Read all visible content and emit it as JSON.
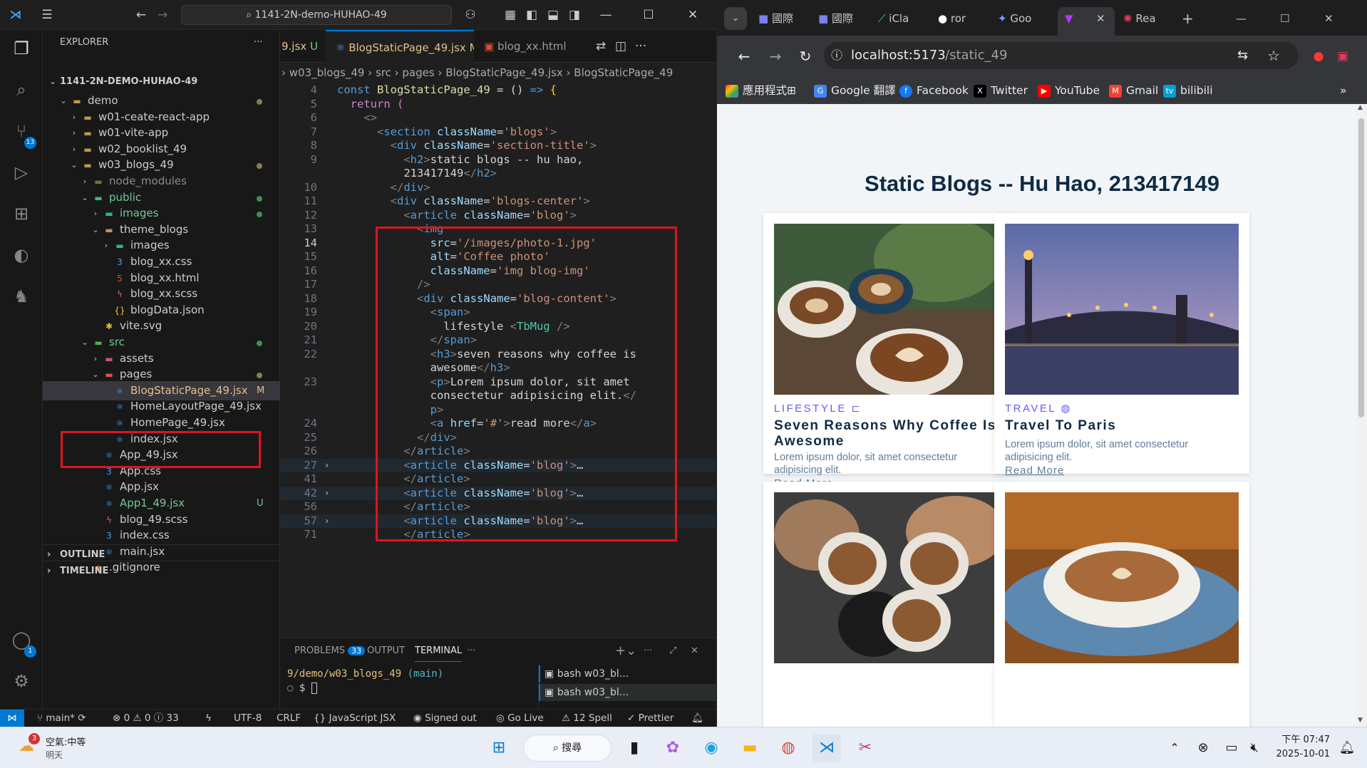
{
  "vscode": {
    "title_search": "1141-2N-demo-HUHAO-49",
    "activity_badges": {
      "source_control": "13",
      "accounts": "1"
    },
    "sidebar": {
      "header": "EXPLORER",
      "root": "1141-2N-DEMO-HUHAO-49",
      "tree": [
        {
          "label": "demo",
          "type": "folder",
          "open": true,
          "depth": 1,
          "status": "dot-gray"
        },
        {
          "label": "w01-ceate-react-app",
          "type": "folder",
          "open": false,
          "depth": 2,
          "status": ""
        },
        {
          "label": "w01-vite-app",
          "type": "folder",
          "open": false,
          "depth": 2,
          "status": ""
        },
        {
          "label": "w02_booklist_49",
          "type": "folder",
          "open": false,
          "depth": 2,
          "status": ""
        },
        {
          "label": "w03_blogs_49",
          "type": "folder",
          "open": true,
          "depth": 2,
          "status": "dot-gray"
        },
        {
          "label": "node_modules",
          "type": "folder-dim",
          "open": false,
          "depth": 3,
          "status": ""
        },
        {
          "label": "public",
          "type": "folder-public",
          "open": true,
          "depth": 3,
          "status": "dot-green"
        },
        {
          "label": "images",
          "type": "folder-images",
          "open": false,
          "depth": 4,
          "status": "dot-green"
        },
        {
          "label": "theme_blogs",
          "type": "folder",
          "open": true,
          "depth": 4,
          "status": ""
        },
        {
          "label": "images",
          "type": "folder-images",
          "open": false,
          "depth": 5,
          "status": ""
        },
        {
          "label": "blog_xx.css",
          "type": "css",
          "depth": 5,
          "status": ""
        },
        {
          "label": "blog_xx.html",
          "type": "html",
          "depth": 5,
          "status": ""
        },
        {
          "label": "blog_xx.scss",
          "type": "scss",
          "depth": 5,
          "status": ""
        },
        {
          "label": "blogData.json",
          "type": "json",
          "depth": 5,
          "status": ""
        },
        {
          "label": "vite.svg",
          "type": "svg",
          "depth": 4,
          "status": ""
        },
        {
          "label": "src",
          "type": "folder-src",
          "open": true,
          "depth": 3,
          "status": "dot-green"
        },
        {
          "label": "assets",
          "type": "folder-assets",
          "open": false,
          "depth": 4,
          "status": ""
        },
        {
          "label": "pages",
          "type": "folder-pages",
          "open": true,
          "depth": 4,
          "status": "dot-gray"
        },
        {
          "label": "BlogStaticPage_49.jsx",
          "type": "jsx",
          "depth": 5,
          "status": "M",
          "selected": true
        },
        {
          "label": "HomeLayoutPage_49.jsx",
          "type": "jsx",
          "depth": 5,
          "status": ""
        },
        {
          "label": "HomePage_49.jsx",
          "type": "jsx",
          "depth": 5,
          "status": ""
        },
        {
          "label": "index.jsx",
          "type": "jsx",
          "depth": 5,
          "status": ""
        },
        {
          "label": "App_49.jsx",
          "type": "jsx",
          "depth": 4,
          "status": ""
        },
        {
          "label": "App.css",
          "type": "css",
          "depth": 4,
          "status": ""
        },
        {
          "label": "App.jsx",
          "type": "jsx",
          "depth": 4,
          "status": ""
        },
        {
          "label": "App1_49.jsx",
          "type": "jsx",
          "depth": 4,
          "status": "U"
        },
        {
          "label": "blog_49.scss",
          "type": "scss",
          "depth": 4,
          "status": ""
        },
        {
          "label": "index.css",
          "type": "css",
          "depth": 4,
          "status": ""
        },
        {
          "label": "main.jsx",
          "type": "jsx",
          "depth": 4,
          "status": ""
        },
        {
          "label": ".gitignore",
          "type": "git",
          "depth": 3,
          "status": ""
        }
      ],
      "outline": "OUTLINE",
      "timeline": "TIMELINE"
    },
    "tabs": [
      {
        "label": "9.jsx",
        "mark": "U",
        "active": false
      },
      {
        "label": "BlogStaticPage_49.jsx",
        "mark": "M",
        "active": true
      },
      {
        "label": "blog_xx.html",
        "mark": "",
        "active": false
      }
    ],
    "breadcrumb": "› w03_blogs_49 › src › pages › BlogStaticPage_49.jsx › BlogStaticPage_49",
    "code_lines": [
      {
        "n": "4",
        "html": "<span class='k'>const</span> <span class='f'>BlogStaticPage_49</span> = () <span class='k'>=></span> <span class='b'>{</span>"
      },
      {
        "n": "5",
        "html": "  <span class='kc'>return</span> <span class='kc'>(</span>"
      },
      {
        "n": "6",
        "html": "    <span class='p'>&lt;&gt;</span>"
      },
      {
        "n": "7",
        "html": "      <span class='p'>&lt;</span><span class='t'>section</span> <span class='a'>className</span>=<span class='s'>'blogs'</span><span class='p'>&gt;</span>"
      },
      {
        "n": "8",
        "html": "        <span class='p'>&lt;</span><span class='t'>div</span> <span class='a'>className</span>=<span class='s'>'section-title'</span><span class='p'>&gt;</span>"
      },
      {
        "n": "9",
        "html": "          <span class='p'>&lt;</span><span class='t'>h2</span><span class='p'>&gt;</span>static blogs -- hu hao,"
      },
      {
        "n": "",
        "html": "          213417149<span class='p'>&lt;/</span><span class='t'>h2</span><span class='p'>&gt;</span>"
      },
      {
        "n": "10",
        "html": "        <span class='p'>&lt;/</span><span class='t'>div</span><span class='p'>&gt;</span>"
      },
      {
        "n": "11",
        "html": "        <span class='p'>&lt;</span><span class='t'>div</span> <span class='a'>className</span>=<span class='s'>'blogs-center'</span><span class='p'>&gt;</span>"
      },
      {
        "n": "12",
        "html": "          <span class='p'>&lt;</span><span class='t'>article</span> <span class='a'>className</span>=<span class='s'>'blog'</span><span class='p'>&gt;</span>"
      },
      {
        "n": "13",
        "html": "            <span class='p'>&lt;</span><span class='t'>img</span>"
      },
      {
        "n": "14",
        "html": "              <span class='a'>src</span>=<span class='s'>'/images/photo-1.jpg'</span>",
        "cur": true
      },
      {
        "n": "15",
        "html": "              <span class='a'>alt</span>=<span class='s'>'Coffee photo'</span>"
      },
      {
        "n": "16",
        "html": "              <span class='a'>className</span>=<span class='s'>'img blog-img'</span>"
      },
      {
        "n": "17",
        "html": "            <span class='p'>/&gt;</span>"
      },
      {
        "n": "18",
        "html": "            <span class='p'>&lt;</span><span class='t'>div</span> <span class='a'>className</span>=<span class='s'>'blog-content'</span><span class='p'>&gt;</span>"
      },
      {
        "n": "19",
        "html": "              <span class='p'>&lt;</span><span class='t'>span</span><span class='p'>&gt;</span>"
      },
      {
        "n": "20",
        "html": "                lifestyle <span class='p'>&lt;</span><span class='c'>TbMug</span> <span class='p'>/&gt;</span>"
      },
      {
        "n": "21",
        "html": "              <span class='p'>&lt;/</span><span class='t'>span</span><span class='p'>&gt;</span>"
      },
      {
        "n": "22",
        "html": "              <span class='p'>&lt;</span><span class='t'>h3</span><span class='p'>&gt;</span>seven reasons why coffee is"
      },
      {
        "n": "",
        "html": "              awesome<span class='p'>&lt;/</span><span class='t'>h3</span><span class='p'>&gt;</span>"
      },
      {
        "n": "23",
        "html": "              <span class='p'>&lt;</span><span class='t'>p</span><span class='p'>&gt;</span>Lorem ipsum dolor, sit amet"
      },
      {
        "n": "",
        "html": "              consectetur adipisicing elit.<span class='p'>&lt;/</span>"
      },
      {
        "n": "",
        "html": "              <span class='t'>p</span><span class='p'>&gt;</span>"
      },
      {
        "n": "24",
        "html": "              <span class='p'>&lt;</span><span class='t'>a</span> <span class='a'>href</span>=<span class='s'>'#'</span><span class='p'>&gt;</span>read more<span class='p'>&lt;/</span><span class='t'>a</span><span class='p'>&gt;</span>"
      },
      {
        "n": "25",
        "html": "            <span class='p'>&lt;/</span><span class='t'>div</span><span class='p'>&gt;</span>"
      },
      {
        "n": "26",
        "html": "          <span class='p'>&lt;/</span><span class='t'>article</span><span class='p'>&gt;</span>"
      },
      {
        "n": "27",
        "html": "          <span class='p'>&lt;</span><span class='t'>article</span> <span class='a'>className</span>=<span class='s'>'blog'</span><span class='p'>&gt;</span>…",
        "fold": true,
        "hl": true
      },
      {
        "n": "41",
        "html": "          <span class='p'>&lt;/</span><span class='t'>article</span><span class='p'>&gt;</span>"
      },
      {
        "n": "42",
        "html": "          <span class='p'>&lt;</span><span class='t'>article</span> <span class='a'>className</span>=<span class='s'>'blog'</span><span class='p'>&gt;</span>…",
        "fold": true,
        "hl": true
      },
      {
        "n": "56",
        "html": "          <span class='p'>&lt;/</span><span class='t'>article</span><span class='p'>&gt;</span>"
      },
      {
        "n": "57",
        "html": "          <span class='p'>&lt;</span><span class='t'>article</span> <span class='a'>className</span>=<span class='s'>'blog'</span><span class='p'>&gt;</span>…",
        "fold": true,
        "hl": true
      },
      {
        "n": "71",
        "html": "          <span class='p'>&lt;/</span><span class='t'>article</span><span class='p'>&gt;</span>"
      }
    ],
    "panel": {
      "tabs": [
        "PROBLEMS",
        "OUTPUT",
        "TERMINAL"
      ],
      "problems_count": "33",
      "active_tab": "TERMINAL",
      "terminal_path": "9/demo/w03_blogs_49",
      "terminal_branch": "(main)",
      "prompt": "$",
      "terminals": [
        "bash w03_bl...",
        "bash w03_bl..."
      ]
    },
    "status": {
      "branch": "main*",
      "problems": "⊗ 0 ⚠ 0 ⓘ 33",
      "encoding": "UTF-8",
      "eol": "CRLF",
      "language": "{} JavaScript JSX",
      "signed": "Signed out",
      "golive": "Go Live",
      "spell": "12 Spell",
      "prettier": "✓ Prettier"
    }
  },
  "chrome": {
    "tabs": [
      "國際",
      "國際",
      "iCla",
      "ror",
      "Goo",
      "",
      "Rea"
    ],
    "url_host": "localhost:5173",
    "url_path": "/static_49",
    "bookmarks": [
      "應用程式",
      "Google 翻譯",
      "Facebook",
      "Twitter",
      "YouTube",
      "Gmail",
      "bilibili"
    ],
    "page": {
      "title": "Static Blogs -- Hu Hao, 213417149",
      "cards": [
        {
          "category": "LIFESTYLE",
          "title": "Seven Reasons Why Coffee Is Awesome",
          "desc": "Lorem ipsum dolor, sit amet consectetur adipisicing elit.",
          "link": "Read More"
        },
        {
          "category": "TRAVEL",
          "title": "Travel To Paris",
          "desc": "Lorem ipsum dolor, sit amet consectetur adipisicing elit.",
          "link": "Read More"
        }
      ]
    }
  },
  "taskbar": {
    "weather_badge": "3",
    "weather_line1": "空氣:中等",
    "weather_line2": "明天",
    "search": "搜尋",
    "time": "下午 07:47",
    "date": "2025-10-01"
  }
}
